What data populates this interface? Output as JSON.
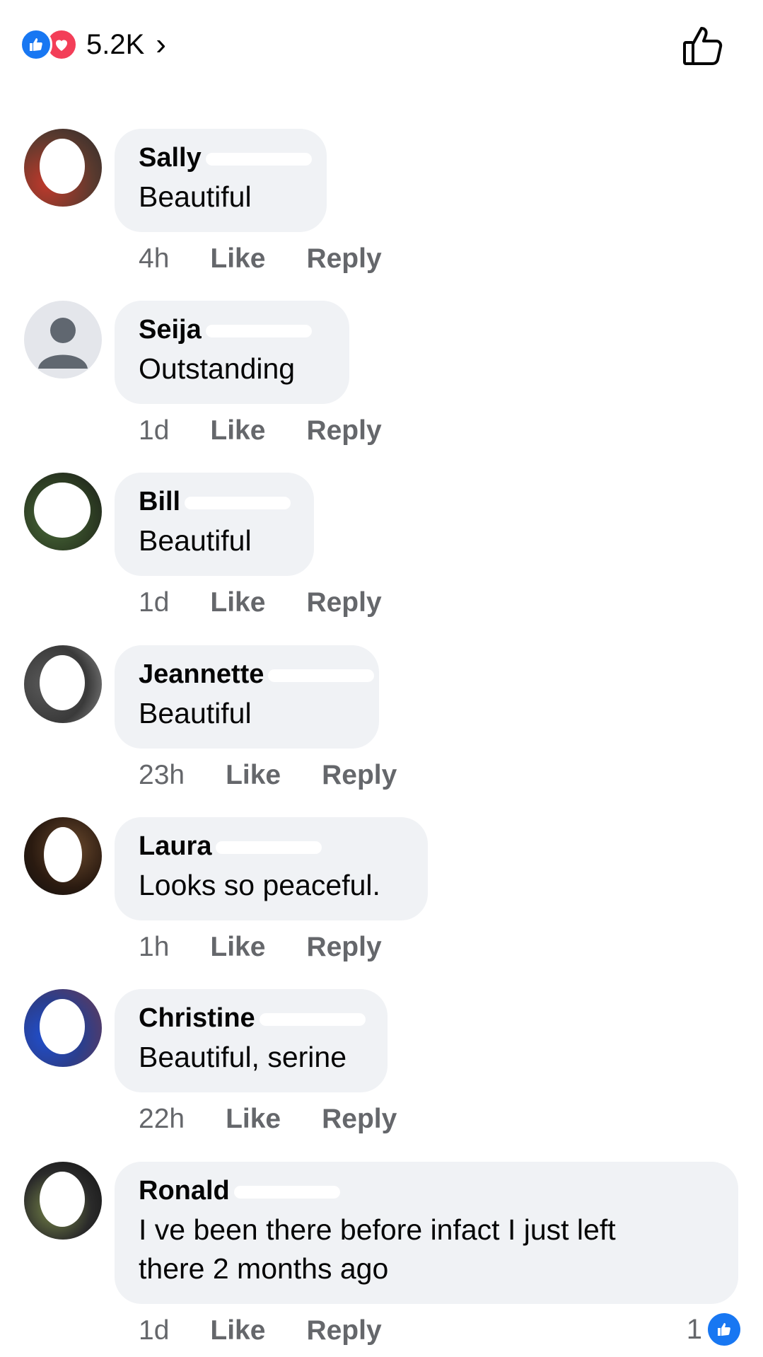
{
  "header": {
    "reaction_count": "5.2K",
    "chevron": "›",
    "like_icon": "thumbs-up-outline-icon",
    "reaction_icons": [
      "like-reaction-icon",
      "love-reaction-icon"
    ],
    "colors": {
      "like": "#1877f2",
      "love": "#f33e58"
    }
  },
  "comments": [
    {
      "author": "Sally",
      "text": "Beautiful",
      "time": "4h",
      "like": "Like",
      "reply": "Reply"
    },
    {
      "author": "Seija",
      "text": "Outstanding",
      "time": "1d",
      "like": "Like",
      "reply": "Reply"
    },
    {
      "author": "Bill",
      "text": "Beautiful",
      "time": "1d",
      "like": "Like",
      "reply": "Reply"
    },
    {
      "author": "Jeannette",
      "text": "Beautiful",
      "time": "23h",
      "like": "Like",
      "reply": "Reply"
    },
    {
      "author": "Laura",
      "text": "Looks so peaceful.",
      "time": "1h",
      "like": "Like",
      "reply": "Reply"
    },
    {
      "author": "Christine",
      "text": "Beautiful, serine",
      "time": "22h",
      "like": "Like",
      "reply": "Reply"
    },
    {
      "author": "Ronald",
      "text": "I ve been there before infact I just left there 2 months ago",
      "time": "1d",
      "like": "Like",
      "reply": "Reply",
      "reactions": "1"
    }
  ]
}
